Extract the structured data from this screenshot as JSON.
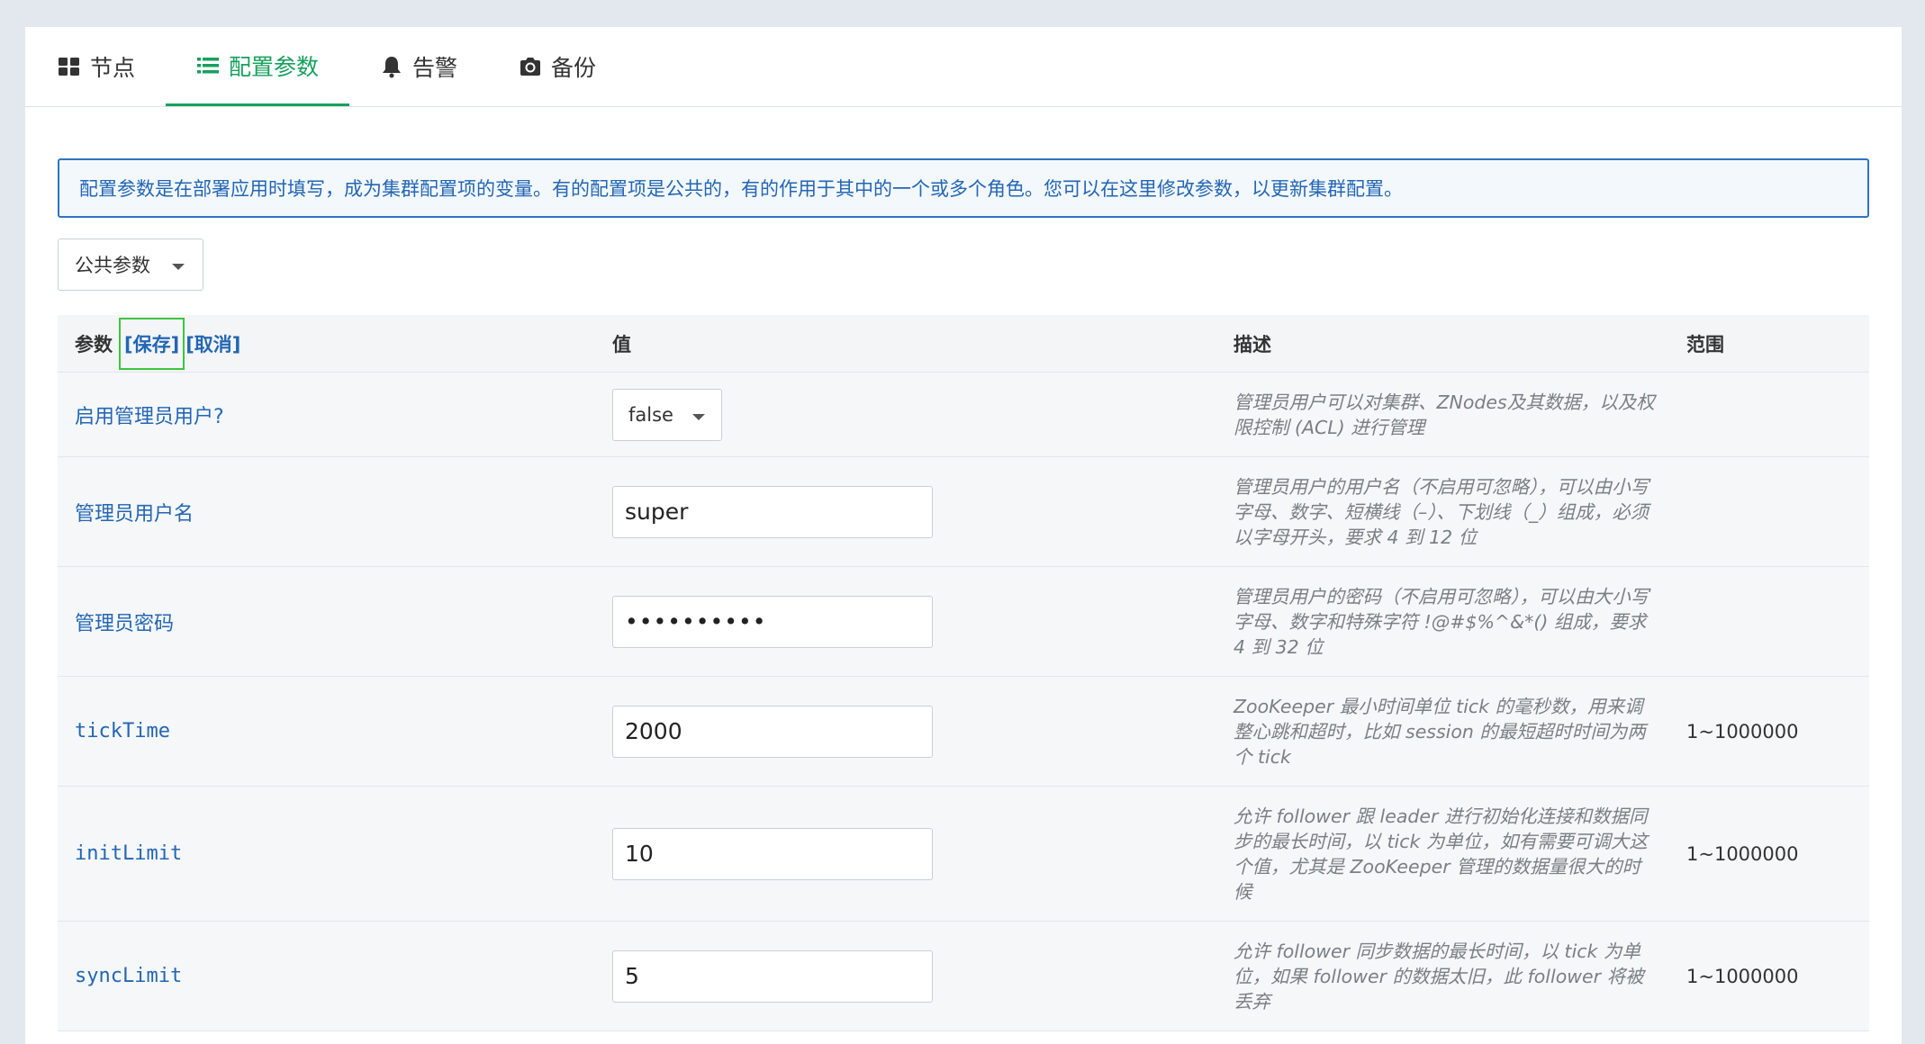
{
  "tabs": [
    {
      "label": "节点",
      "icon": "grid-icon",
      "active": false
    },
    {
      "label": "配置参数",
      "icon": "list-icon",
      "active": true
    },
    {
      "label": "告警",
      "icon": "bell-icon",
      "active": false
    },
    {
      "label": "备份",
      "icon": "camera-icon",
      "active": false
    }
  ],
  "info_text": "配置参数是在部署应用时填写，成为集群配置项的变量。有的配置项是公共的，有的作用于其中的一个或多个角色。您可以在这里修改参数，以更新集群配置。",
  "group_select": {
    "value": "公共参数"
  },
  "table": {
    "headers": {
      "param": "参数",
      "save": "[保存]",
      "cancel": "[取消]",
      "value": "值",
      "desc": "描述",
      "range": "范围"
    },
    "rows": [
      {
        "label": "启用管理员用户?",
        "type": "select",
        "value": "false",
        "desc": "管理员用户可以对集群、ZNodes及其数据，以及权限控制 (ACL) 进行管理",
        "range": ""
      },
      {
        "label": "管理员用户名",
        "type": "text",
        "value": "super",
        "desc": "管理员用户的用户名（不启用可忽略），可以由小写字母、数字、短横线（–）、下划线（_）组成，必须以字母开头，要求 4 到 12 位",
        "range": ""
      },
      {
        "label": "管理员密码",
        "type": "password",
        "value": "••••••••••",
        "desc": "管理员用户的密码（不启用可忽略），可以由大小写字母、数字和特殊字符 !@#$%^&*() 组成，要求 4 到 32 位",
        "range": ""
      },
      {
        "label": "tickTime",
        "type": "text",
        "value": "2000",
        "desc": "ZooKeeper 最小时间单位 tick 的毫秒数，用来调整心跳和超时，比如 session 的最短超时时间为两个 tick",
        "range": "1~1000000"
      },
      {
        "label": "initLimit",
        "type": "text",
        "value": "10",
        "desc": "允许 follower 跟 leader 进行初始化连接和数据同步的最长时间，以 tick 为单位，如有需要可调大这个值，尤其是 ZooKeeper 管理的数据量很大的时候",
        "range": "1~1000000"
      },
      {
        "label": "syncLimit",
        "type": "text",
        "value": "5",
        "desc": "允许 follower 同步数据的最长时间，以 tick 为单位，如果 follower 的数据太旧，此 follower 将被丢弃",
        "range": "1~1000000"
      }
    ]
  }
}
